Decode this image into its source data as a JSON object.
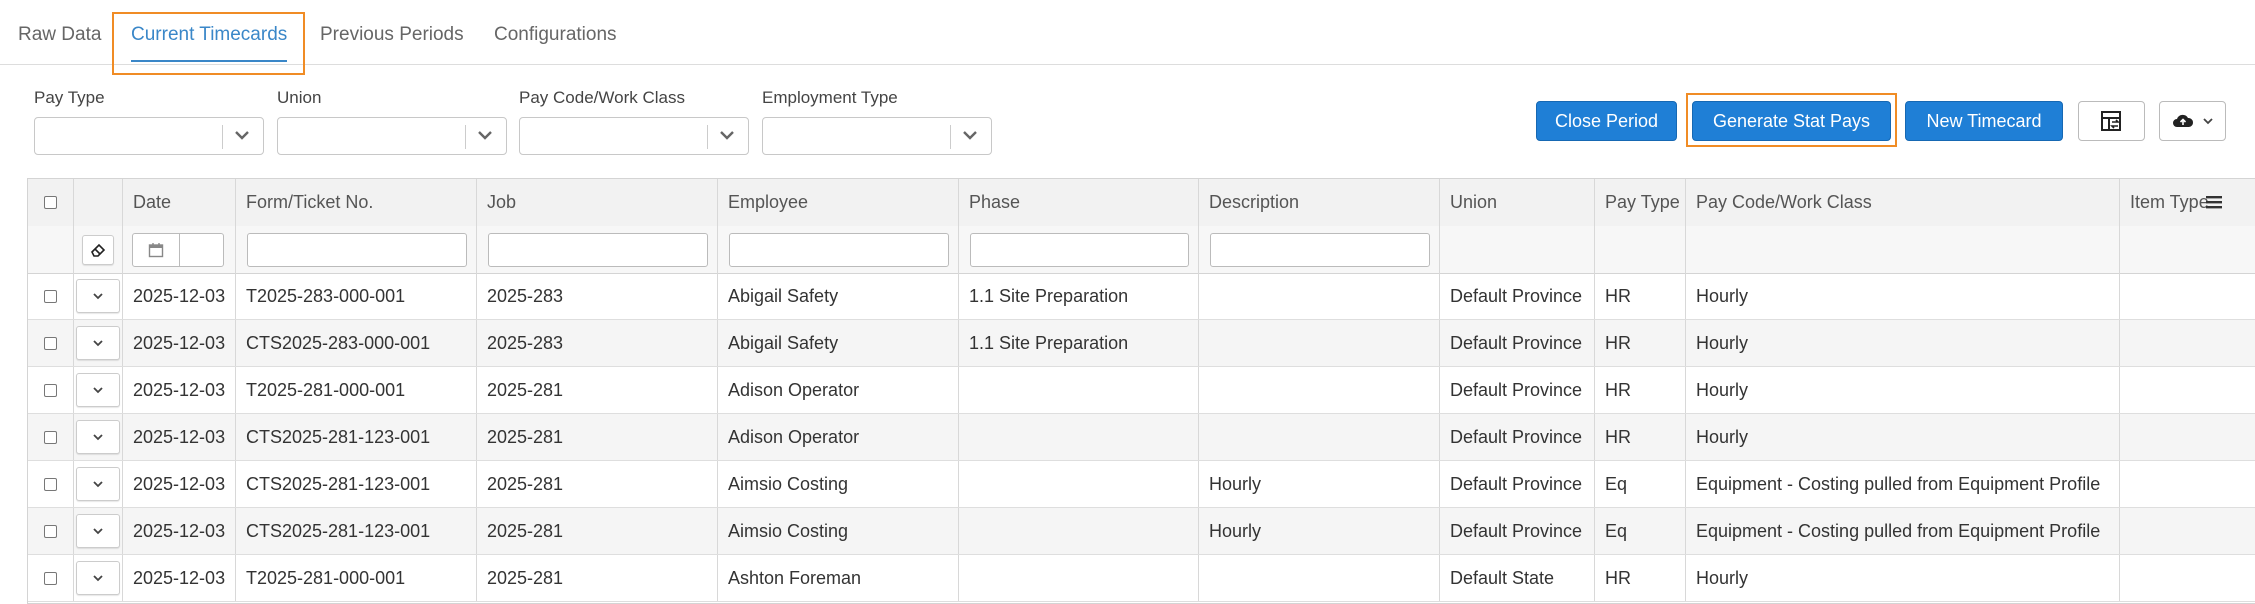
{
  "tabs": [
    {
      "label": "Raw Data"
    },
    {
      "label": "Current Timecards"
    },
    {
      "label": "Previous Periods"
    },
    {
      "label": "Configurations"
    }
  ],
  "filters": {
    "pay_type": {
      "label": "Pay Type",
      "value": ""
    },
    "union": {
      "label": "Union",
      "value": ""
    },
    "pay_code": {
      "label": "Pay Code/Work Class",
      "value": ""
    },
    "employment_type": {
      "label": "Employment Type",
      "value": ""
    }
  },
  "toolbar": {
    "close_period": "Close Period",
    "generate_stat_pays": "Generate Stat Pays",
    "new_timecard": "New Timecard",
    "column_chooser_icon": "columns-swap-icon",
    "export_icon": "cloud-upload-icon"
  },
  "table": {
    "columns": [
      "Date",
      "Form/Ticket No.",
      "Job",
      "Employee",
      "Phase",
      "Description",
      "Union",
      "Pay Type",
      "Pay Code/Work Class",
      "Item Type"
    ],
    "rows": [
      {
        "date": "2025-12-03",
        "ticket": "T2025-283-000-001",
        "job": "2025-283",
        "employee": "Abigail Safety",
        "phase": "1.1 Site Preparation",
        "description": "",
        "union": "Default Province",
        "pay_type": "HR",
        "pay_code": "Hourly"
      },
      {
        "date": "2025-12-03",
        "ticket": "CTS2025-283-000-001",
        "job": "2025-283",
        "employee": "Abigail Safety",
        "phase": "1.1 Site Preparation",
        "description": "",
        "union": "Default Province",
        "pay_type": "HR",
        "pay_code": "Hourly"
      },
      {
        "date": "2025-12-03",
        "ticket": "T2025-281-000-001",
        "job": "2025-281",
        "employee": "Adison Operator",
        "phase": "",
        "description": "",
        "union": "Default Province",
        "pay_type": "HR",
        "pay_code": "Hourly"
      },
      {
        "date": "2025-12-03",
        "ticket": "CTS2025-281-123-001",
        "job": "2025-281",
        "employee": "Adison Operator",
        "phase": "",
        "description": "",
        "union": "Default Province",
        "pay_type": "HR",
        "pay_code": "Hourly"
      },
      {
        "date": "2025-12-03",
        "ticket": "CTS2025-281-123-001",
        "job": "2025-281",
        "employee": "Aimsio Costing",
        "phase": "",
        "description": "Hourly",
        "union": "Default Province",
        "pay_type": "Eq",
        "pay_code": "Equipment - Costing pulled from Equipment Profile"
      },
      {
        "date": "2025-12-03",
        "ticket": "CTS2025-281-123-001",
        "job": "2025-281",
        "employee": "Aimsio Costing",
        "phase": "",
        "description": "Hourly",
        "union": "Default Province",
        "pay_type": "Eq",
        "pay_code": "Equipment - Costing pulled from Equipment Profile"
      },
      {
        "date": "2025-12-03",
        "ticket": "T2025-281-000-001",
        "job": "2025-281",
        "employee": "Ashton Foreman",
        "phase": "",
        "description": "",
        "union": "Default State",
        "pay_type": "HR",
        "pay_code": "Hourly"
      }
    ]
  },
  "colors": {
    "accent": "#1f7fd6",
    "tab_active": "#3a87c8",
    "highlight": "#f08c25"
  }
}
